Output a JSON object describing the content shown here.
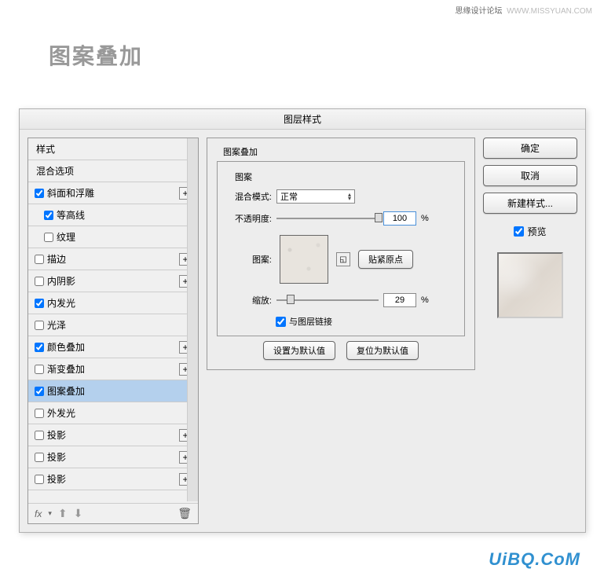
{
  "top_right": {
    "text": "思缘设计论坛",
    "url": "WWW.MISSYUAN.COM"
  },
  "header": {
    "title": "图案叠加"
  },
  "dialog": {
    "title": "图层样式",
    "styles_header1": "样式",
    "styles_header2": "混合选项",
    "items": [
      {
        "label": "斜面和浮雕",
        "checked": true,
        "addable": true
      },
      {
        "label": "等高线",
        "checked": true,
        "indent": true
      },
      {
        "label": "纹理",
        "checked": false,
        "indent": true
      },
      {
        "label": "描边",
        "checked": false,
        "addable": true
      },
      {
        "label": "内阴影",
        "checked": false,
        "addable": true
      },
      {
        "label": "内发光",
        "checked": true
      },
      {
        "label": "光泽",
        "checked": false
      },
      {
        "label": "颜色叠加",
        "checked": true,
        "addable": true
      },
      {
        "label": "渐变叠加",
        "checked": false,
        "addable": true
      },
      {
        "label": "图案叠加",
        "checked": true,
        "active": true
      },
      {
        "label": "外发光",
        "checked": false
      },
      {
        "label": "投影",
        "checked": false,
        "addable": true
      },
      {
        "label": "投影",
        "checked": false,
        "addable": true
      },
      {
        "label": "投影",
        "checked": false,
        "addable": true
      }
    ],
    "footer_fx": "fx",
    "section_title": "图案叠加",
    "pattern_group": "图案",
    "blend_mode_label": "混合模式:",
    "blend_mode_value": "正常",
    "opacity_label": "不透明度:",
    "opacity_value": "100",
    "percent": "%",
    "pattern_label": "图案:",
    "snap_origin": "贴紧原点",
    "scale_label": "缩放:",
    "scale_value": "29",
    "link_layer": "与图层链接",
    "link_layer_checked": true,
    "set_default": "设置为默认值",
    "reset_default": "复位为默认值",
    "buttons": {
      "ok": "确定",
      "cancel": "取消",
      "new_style": "新建样式..."
    },
    "preview_label": "预览",
    "preview_checked": true
  },
  "watermark": "UiBQ.CoM"
}
